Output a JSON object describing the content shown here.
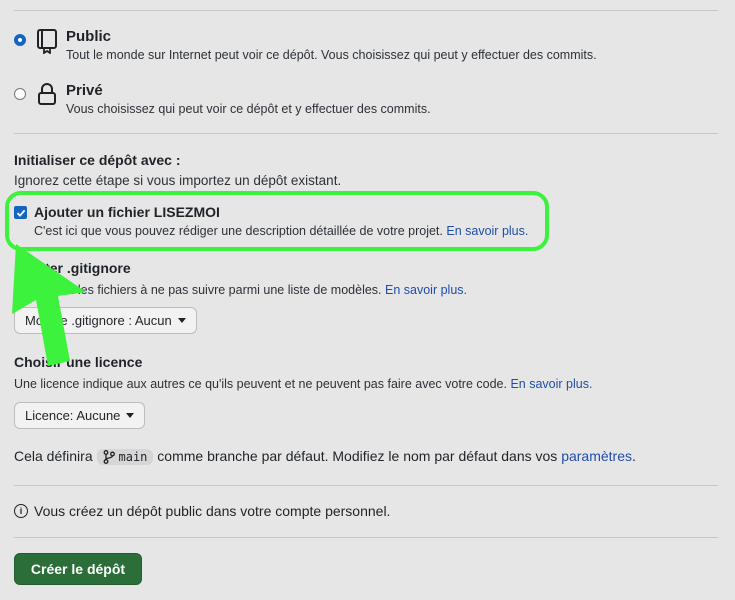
{
  "visibility": {
    "public": {
      "title": "Public",
      "description": "Tout le monde sur Internet peut voir ce dépôt. Vous choisissez qui peut y effectuer des commits.",
      "selected": true
    },
    "private": {
      "title": "Privé",
      "description": "Vous choisissez qui peut voir ce dépôt et y effectuer des commits.",
      "selected": false
    }
  },
  "init": {
    "heading": "Initialiser ce dépôt avec :",
    "subheading": "Ignorez cette étape si vous importez un dépôt existant.",
    "readme": {
      "title": "Ajouter un fichier LISEZMOI",
      "description": "C'est ici que vous pouvez rédiger une description détaillée de votre projet.",
      "link": "En savoir plus.",
      "checked": true
    }
  },
  "gitignore": {
    "heading": "Ajouter .gitignore",
    "description": "Choisissez les fichiers à ne pas suivre parmi une liste de modèles.",
    "link": "En savoir plus.",
    "button": "Modèle .gitignore : Aucun"
  },
  "license": {
    "heading": "Choisir une licence",
    "description": "Une licence indique aux autres ce qu'ils peuvent et ne peuvent pas faire avec votre code.",
    "link": "En savoir plus.",
    "button": "Licence: Aucune"
  },
  "branch": {
    "prefix": "Cela définira",
    "name": "main",
    "middle": "comme branche par défaut. Modifiez le nom par défaut dans vos",
    "link": "paramètres",
    "suffix": "."
  },
  "notice": "Vous créez un dépôt public dans votre compte personnel.",
  "submit": "Créer le dépôt",
  "colors": {
    "accent": "#1565c0",
    "primary_button": "#2c6e3a",
    "annotation": "#3df23d"
  }
}
